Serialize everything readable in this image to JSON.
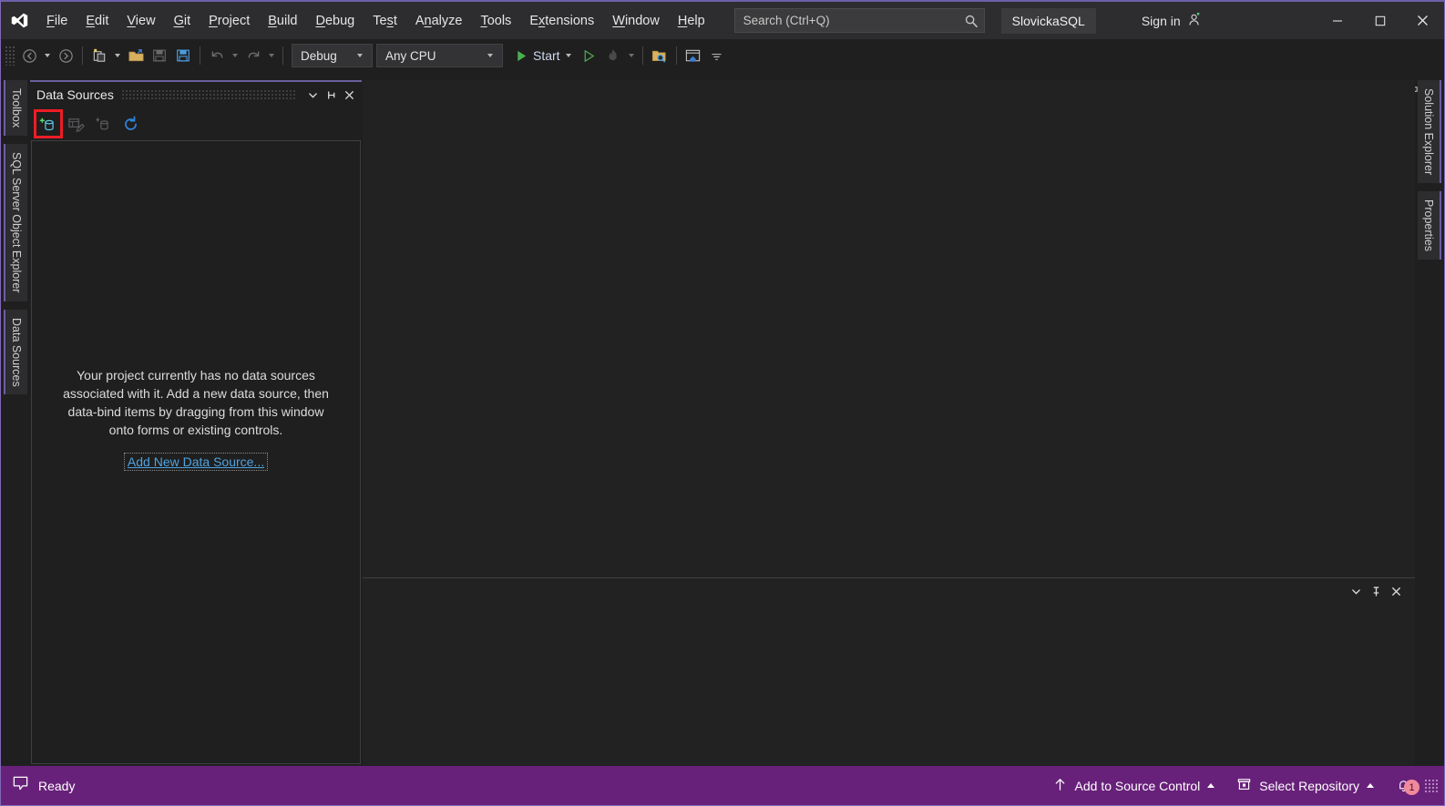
{
  "titlebar": {
    "logo": "visual-studio-logo",
    "menus": [
      {
        "label": "File",
        "accel": "F"
      },
      {
        "label": "Edit",
        "accel": "E"
      },
      {
        "label": "View",
        "accel": "V"
      },
      {
        "label": "Git",
        "accel": "G"
      },
      {
        "label": "Project",
        "accel": "P"
      },
      {
        "label": "Build",
        "accel": "B"
      },
      {
        "label": "Debug",
        "accel": "D"
      },
      {
        "label": "Test",
        "accel": "s"
      },
      {
        "label": "Analyze",
        "accel": "n"
      },
      {
        "label": "Tools",
        "accel": "T"
      },
      {
        "label": "Extensions",
        "accel": "x"
      },
      {
        "label": "Window",
        "accel": "W"
      },
      {
        "label": "Help",
        "accel": "H"
      }
    ],
    "search": {
      "placeholder": "Search (Ctrl+Q)",
      "value": "",
      "icon": "search-icon"
    },
    "project_chip": "SlovickaSQL",
    "sign_in": "Sign in",
    "window_buttons": {
      "minimize": "—",
      "maximize": "☐",
      "close": "✕"
    }
  },
  "toolbar": {
    "nav_back": "navigate-back",
    "nav_forward": "navigate-forward",
    "new_project": "new-project",
    "open_file": "open-file",
    "save": "save",
    "save_all": "save-all",
    "undo": "undo",
    "redo": "redo",
    "configuration": "Debug",
    "platform": "Any CPU",
    "start_label": "Start",
    "live_share": "Live Share"
  },
  "left_tabs": [
    {
      "label": "Toolbox",
      "name": "sidebar-tab-toolbox"
    },
    {
      "label": "SQL Server Object Explorer",
      "name": "sidebar-tab-sql-server-object-explorer"
    },
    {
      "label": "Data Sources",
      "name": "sidebar-tab-data-sources"
    }
  ],
  "right_tabs": [
    {
      "label": "Solution Explorer",
      "name": "sidebar-tab-solution-explorer"
    },
    {
      "label": "Properties",
      "name": "sidebar-tab-properties"
    }
  ],
  "data_sources_panel": {
    "title": "Data Sources",
    "header_buttons": {
      "dropdown": "chevron-down-icon",
      "pin": "pin-icon",
      "close": "close-icon"
    },
    "toolbar_buttons": [
      {
        "name": "add-new-data-source-button",
        "tooltip": "Add New Data Source",
        "highlighted": true
      },
      {
        "name": "edit-dataset-with-designer-button",
        "tooltip": "Edit DataSet with Designer",
        "highlighted": false
      },
      {
        "name": "add-new-data-source-alt-button",
        "tooltip": "Add New Data Source",
        "highlighted": false
      },
      {
        "name": "refresh-button",
        "tooltip": "Refresh",
        "highlighted": false
      }
    ],
    "empty_message": "Your project currently has no data sources associated with it. Add a new data source, then data-bind items by dragging from this window onto forms or existing controls.",
    "empty_link": "Add New Data Source..."
  },
  "bottom_panel": {
    "buttons": {
      "dropdown": "chevron-down-icon",
      "pin": "pin-icon",
      "close": "close-icon"
    }
  },
  "statusbar": {
    "status": "Ready",
    "status_icon": "speech-bubble-icon",
    "add_to_source_control": "Add to Source Control",
    "select_repository": "Select Repository",
    "notification_count": "1"
  },
  "colors": {
    "accent_purple": "#68217a",
    "window_border": "#7e69b8",
    "panel_background": "#1f1f1f",
    "editor_background": "#222222",
    "titlebar_background": "#2d2d30",
    "highlight_red": "#ee1c25",
    "link_blue": "#4ea3e0",
    "start_green": "#4caf50"
  }
}
